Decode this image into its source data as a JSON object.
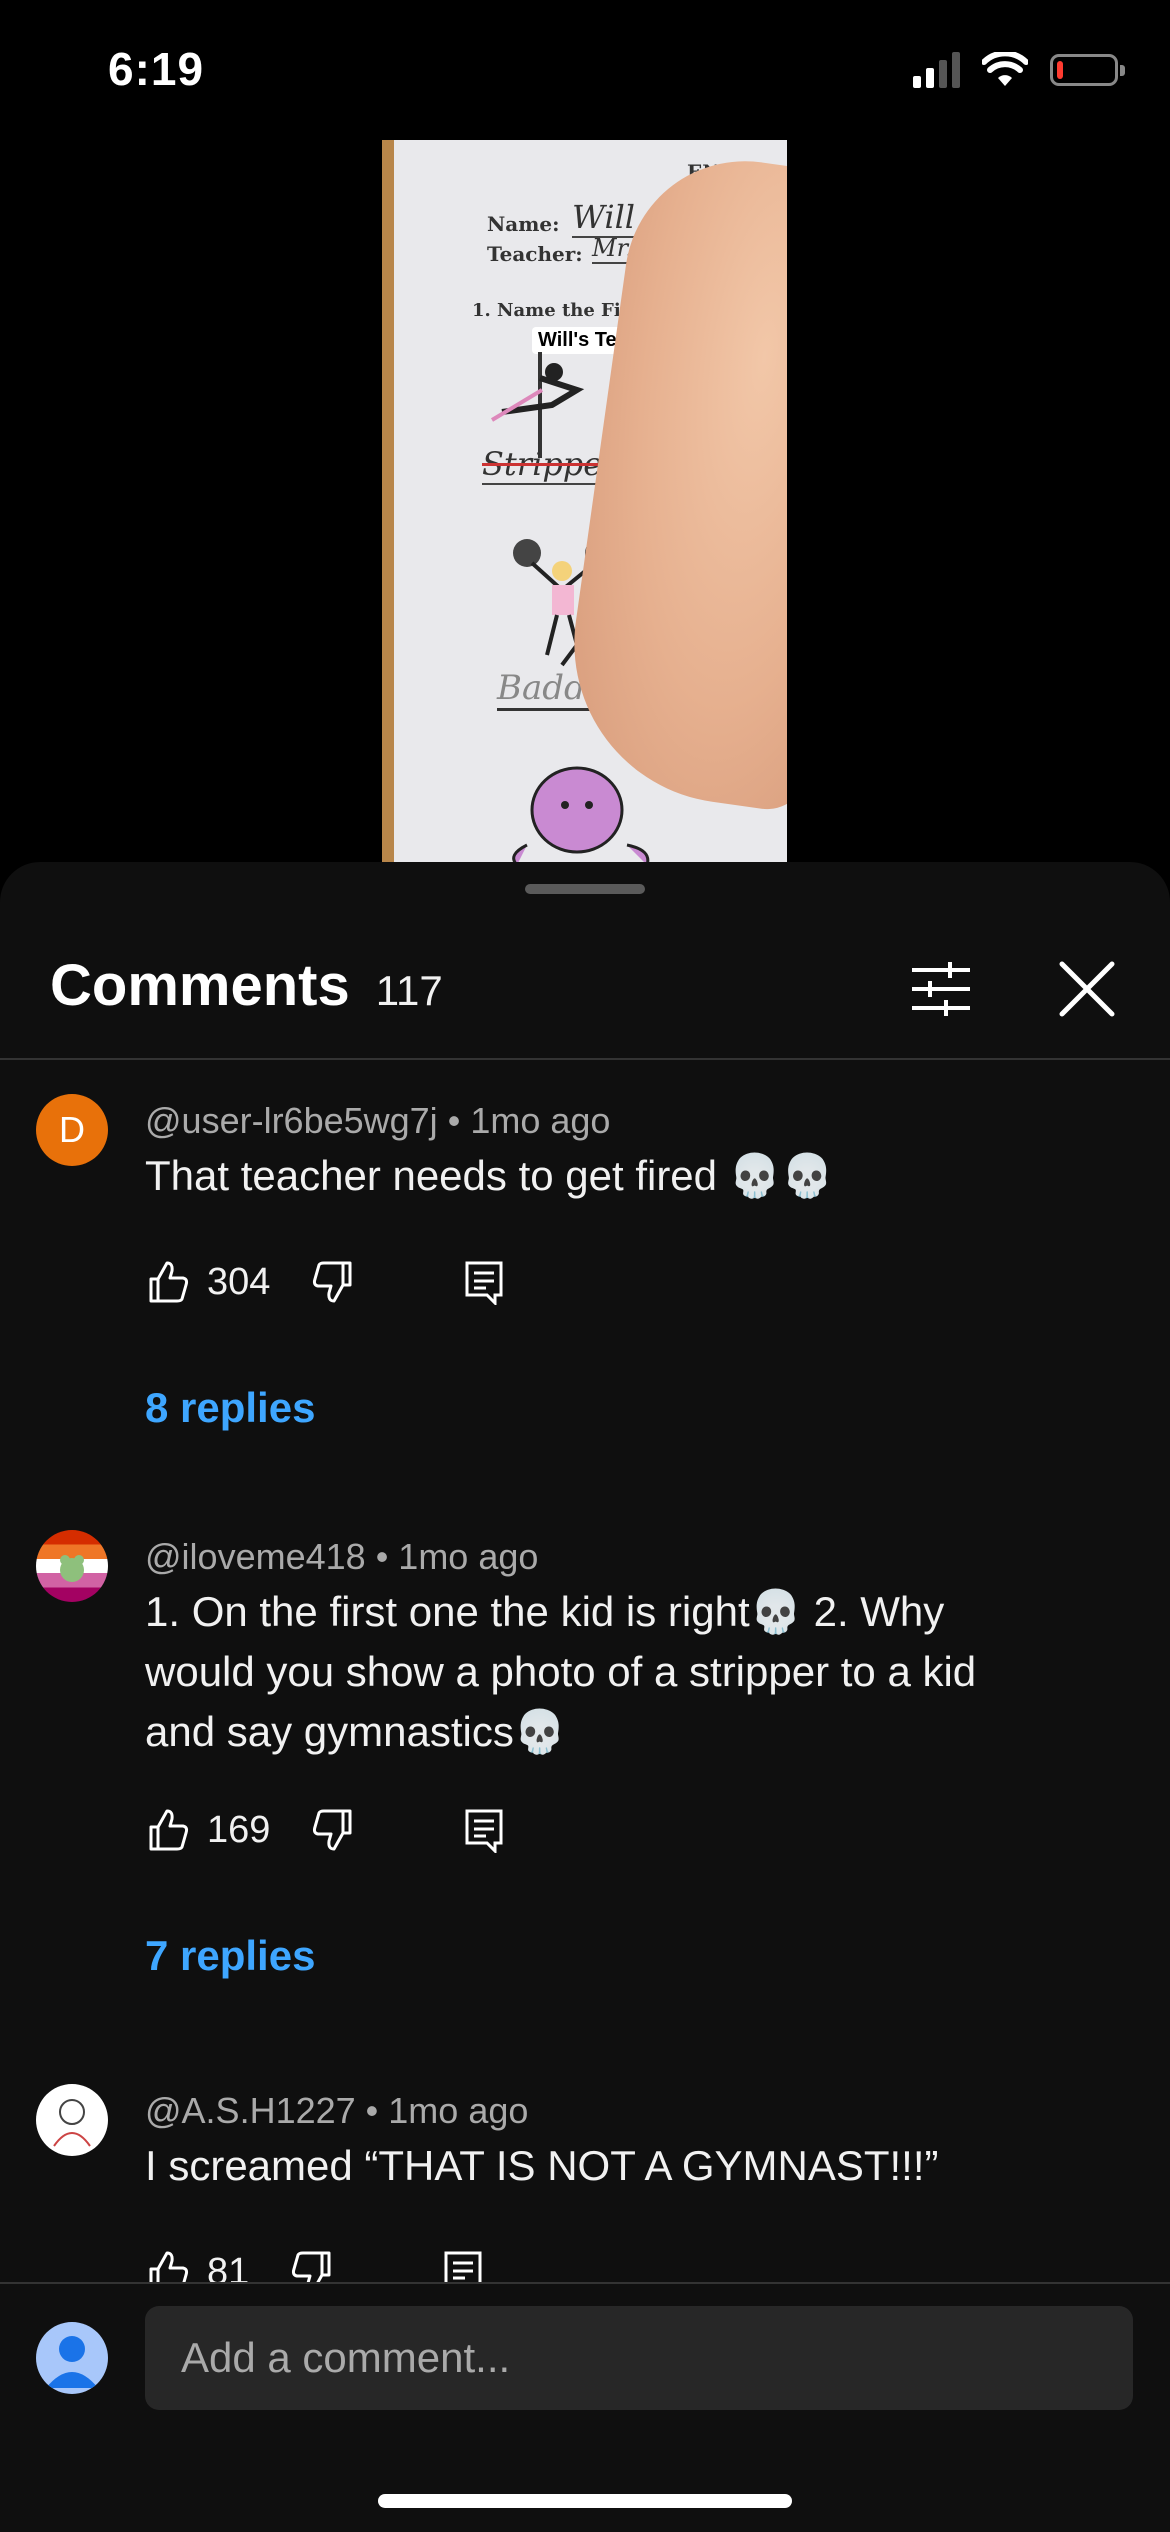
{
  "status": {
    "time": "6:19",
    "signal_bars": 2,
    "battery_level": 0.1,
    "battery_color": "#ff3b30"
  },
  "video": {
    "paper_header": "ENGLIS",
    "name_label": "Name:",
    "name_value": "Will",
    "teacher_label": "Teacher:",
    "teacher_value": "Mr. T",
    "question": "1. Name the Fi",
    "overlay_tag": "Will's Test",
    "answer1": "Stripper",
    "answer2": "Baddie"
  },
  "comments_panel": {
    "title": "Comments",
    "count": "117",
    "accent": "#3ea6ff",
    "items": [
      {
        "author": "@user-lr6be5wg7j",
        "time": "1mo ago",
        "avatar_letter": "D",
        "avatar_color": "#e8710a",
        "text": "That teacher needs to get fired 💀💀",
        "likes": "304",
        "replies": "8 replies"
      },
      {
        "author": "@iloveme418",
        "time": "1mo ago",
        "text": "1. On the first one the kid is right💀 2. Why would you show a photo of a stripper to a kid and say gymnastics💀",
        "likes": "169",
        "replies": "7 replies"
      },
      {
        "author": "@A.S.H1227",
        "time": "1mo ago",
        "text": "I screamed “THAT IS NOT A GYMNAST!!!”",
        "likes": "81"
      }
    ],
    "add_comment_placeholder": "Add a comment..."
  }
}
